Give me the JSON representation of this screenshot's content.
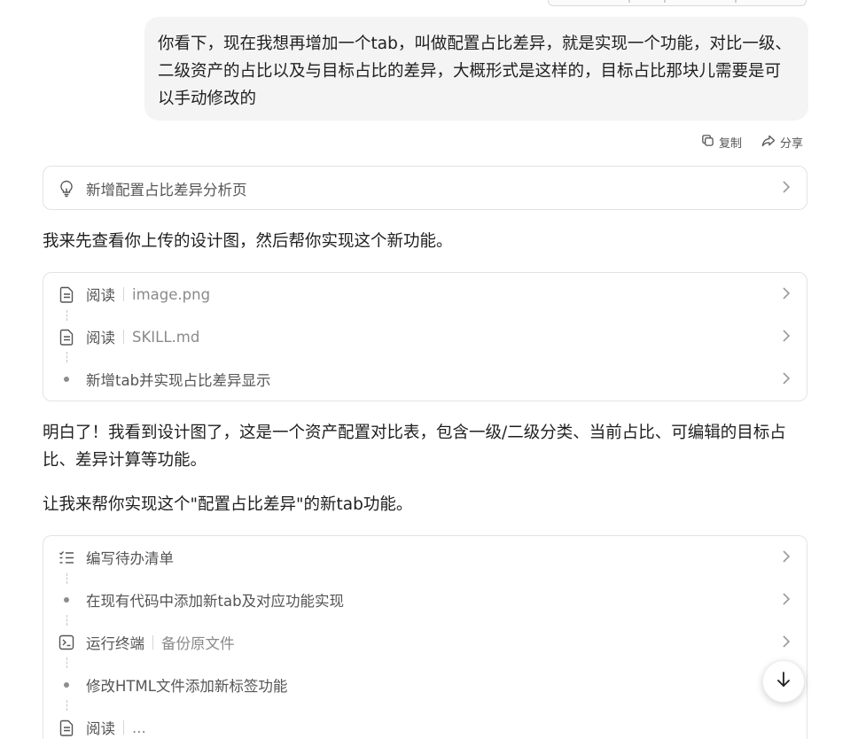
{
  "user_message": {
    "text": "你看下，现在我想再增加一个tab，叫做配置占比差异，就是实现一个功能，对比一级、二级资产的占比以及与目标占比的差异，大概形式是这样的，目标占比那块儿需要是可以手动修改的"
  },
  "message_actions": {
    "copy_label": "复制",
    "share_label": "分享"
  },
  "thought_card": {
    "label": "新增配置占比差异分析页",
    "icon": "lightbulb-icon"
  },
  "reply_1": "我来先查看你上传的设计图，然后帮你实现这个新功能。",
  "steps_1": [
    {
      "icon": "document-icon",
      "label": "阅读",
      "detail": "image.png"
    },
    {
      "icon": "document-icon",
      "label": "阅读",
      "detail": "SKILL.md"
    },
    {
      "icon": "dot",
      "label": "新增tab并实现占比差异显示",
      "detail": ""
    }
  ],
  "reply_2": "明白了！我看到设计图了，这是一个资产配置对比表，包含一级/二级分类、当前占比、可编辑的目标占比、差异计算等功能。",
  "reply_3": "让我来帮你实现这个\"配置占比差异\"的新tab功能。",
  "steps_2": [
    {
      "icon": "checklist-icon",
      "label": "编写待办清单",
      "detail": ""
    },
    {
      "icon": "dot",
      "label": "在现有代码中添加新tab及对应功能实现",
      "detail": ""
    },
    {
      "icon": "terminal-icon",
      "label": "运行终端",
      "detail": "备份原文件"
    },
    {
      "icon": "dot",
      "label": "修改HTML文件添加新标签功能",
      "detail": ""
    },
    {
      "icon": "document-icon",
      "label": "阅读",
      "detail": "..."
    }
  ],
  "scroll_button": {
    "icon": "arrow-down-icon"
  }
}
